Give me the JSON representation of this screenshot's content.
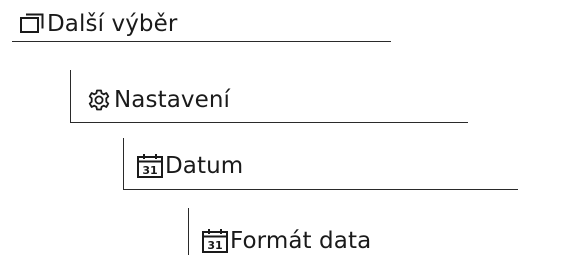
{
  "breadcrumb": {
    "levels": [
      {
        "label": "Další výběr",
        "icon": "window-stack-icon"
      },
      {
        "label": "Nastavení",
        "icon": "gear-icon"
      },
      {
        "label": "Datum",
        "icon": "calendar-icon",
        "icon_text": "31"
      },
      {
        "label": "Formát data",
        "icon": "calendar-icon",
        "icon_text": "31"
      }
    ]
  },
  "colors": {
    "text": "#1a1a1a",
    "rule": "#2a2a2a",
    "background": "#ffffff"
  }
}
